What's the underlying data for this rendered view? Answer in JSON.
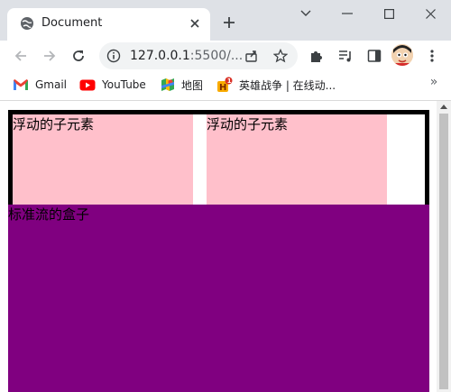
{
  "tab": {
    "title": "Document",
    "favicon": "globe-icon"
  },
  "window": {
    "controls": [
      "chevron-down-icon",
      "minimize-icon",
      "maximize-icon",
      "close-icon"
    ]
  },
  "toolbar": {
    "url_host": "127.0.0.1",
    "url_rest": ":5500/..."
  },
  "bookmarks": {
    "items": [
      {
        "label": "Gmail",
        "icon": "gmail-icon",
        "color": "#ea4335"
      },
      {
        "label": "YouTube",
        "icon": "youtube-icon",
        "color": "#ff0000"
      },
      {
        "label": "地图",
        "icon": "maps-icon",
        "color": "#34a853"
      },
      {
        "label": "英雄战争 | 在线动...",
        "icon": "game-icon",
        "color": "#f9ab00"
      }
    ],
    "more": "»"
  },
  "page": {
    "float_child_1": "浮动的子元素",
    "float_child_2": "浮动的子元素",
    "standard_box": "标准流的盒子",
    "colors": {
      "float_child": "#ffc0cb",
      "standard_box": "#800080",
      "parent_border": "#000000"
    }
  }
}
